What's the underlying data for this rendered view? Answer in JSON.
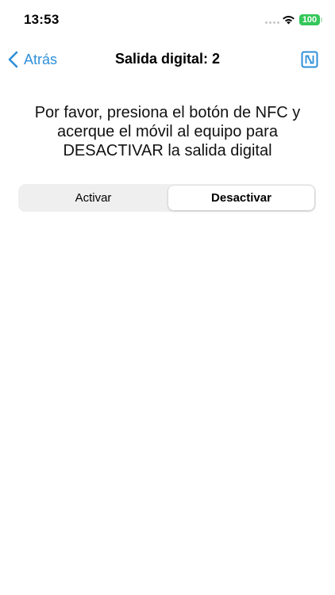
{
  "status_bar": {
    "time": "13:53",
    "battery_level": "100"
  },
  "nav": {
    "back_label": "Atrás",
    "title": "Salida digital: 2",
    "action_icon": "nfc-icon"
  },
  "instructions": {
    "text": "Por favor, presiona el botón de NFC y acerque el móvil al equipo para DESACTIVAR la salida digital"
  },
  "segmented_control": {
    "options": [
      "Activar",
      "Desactivar"
    ],
    "selected": "Desactivar"
  },
  "colors": {
    "accent": "#2f8fd8",
    "battery": "#34c759",
    "segment_background": "#efeff0"
  }
}
